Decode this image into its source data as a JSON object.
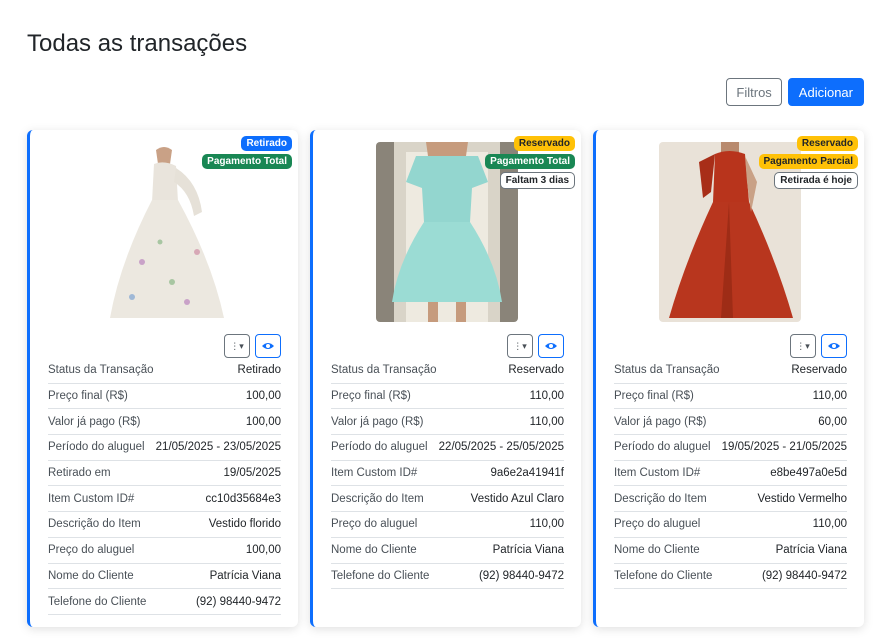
{
  "page": {
    "title": "Todas as transações"
  },
  "toolbar": {
    "filters_label": "Filtros",
    "add_label": "Adicionar"
  },
  "colors": {
    "primary": "#0d6efd",
    "success": "#198754",
    "warning": "#ffc107"
  },
  "cards": [
    {
      "badges": [
        "Retirado",
        "Pagamento Total"
      ],
      "rows": [
        {
          "k": "Status da Transação",
          "v": "Retirado"
        },
        {
          "k": "Preço final (R$)",
          "v": "100,00"
        },
        {
          "k": "Valor já pago (R$)",
          "v": "100,00"
        },
        {
          "k": "Período do aluguel",
          "v": "21/05/2025 - 23/05/2025"
        },
        {
          "k": "Retirado em",
          "v": "19/05/2025"
        },
        {
          "k": "Item Custom ID#",
          "v": "cc10d35684e3"
        },
        {
          "k": "Descrição do Item",
          "v": "Vestido florido"
        },
        {
          "k": "Preço do aluguel",
          "v": "100,00"
        },
        {
          "k": "Nome do Cliente",
          "v": "Patrícia Viana"
        },
        {
          "k": "Telefone do Cliente",
          "v": "(92) 98440-9472"
        }
      ]
    },
    {
      "badges": [
        "Reservado",
        "Pagamento Total",
        "Faltam 3 dias"
      ],
      "rows": [
        {
          "k": "Status da Transação",
          "v": "Reservado"
        },
        {
          "k": "Preço final (R$)",
          "v": "110,00"
        },
        {
          "k": "Valor já pago (R$)",
          "v": "110,00"
        },
        {
          "k": "Período do aluguel",
          "v": "22/05/2025 - 25/05/2025"
        },
        {
          "k": "Item Custom ID#",
          "v": "9a6e2a41941f"
        },
        {
          "k": "Descrição do Item",
          "v": "Vestido Azul Claro"
        },
        {
          "k": "Preço do aluguel",
          "v": "110,00"
        },
        {
          "k": "Nome do Cliente",
          "v": "Patrícia Viana"
        },
        {
          "k": "Telefone do Cliente",
          "v": "(92) 98440-9472"
        }
      ]
    },
    {
      "badges": [
        "Reservado",
        "Pagamento Parcial",
        "Retirada é hoje"
      ],
      "rows": [
        {
          "k": "Status da Transação",
          "v": "Reservado"
        },
        {
          "k": "Preço final (R$)",
          "v": "110,00"
        },
        {
          "k": "Valor já pago (R$)",
          "v": "60,00"
        },
        {
          "k": "Período do aluguel",
          "v": "19/05/2025 - 21/05/2025"
        },
        {
          "k": "Item Custom ID#",
          "v": "e8be497a0e5d"
        },
        {
          "k": "Descrição do Item",
          "v": "Vestido Vermelho"
        },
        {
          "k": "Preço do aluguel",
          "v": "110,00"
        },
        {
          "k": "Nome do Cliente",
          "v": "Patrícia Viana"
        },
        {
          "k": "Telefone do Cliente",
          "v": "(92) 98440-9472"
        }
      ]
    }
  ]
}
